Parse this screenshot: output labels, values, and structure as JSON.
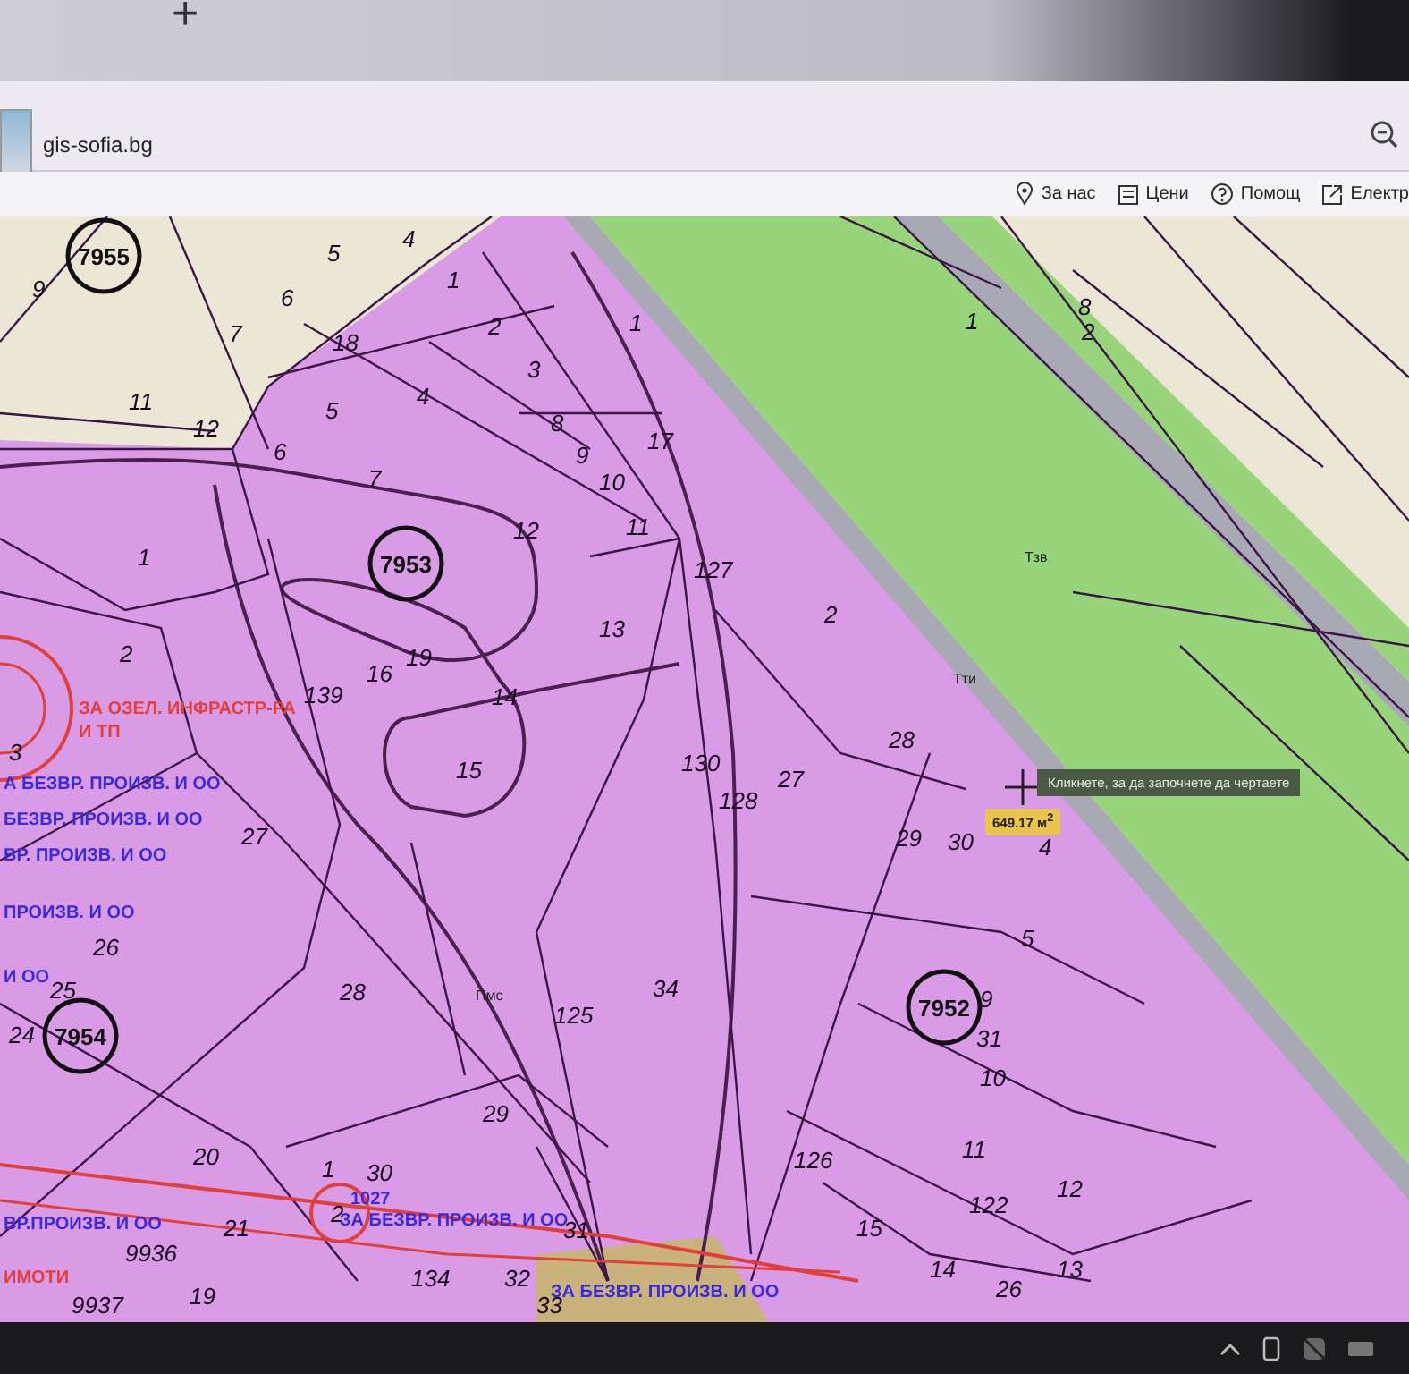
{
  "browser": {
    "new_tab_symbol": "+",
    "site": "gis-sofia.bg"
  },
  "toolbar": [
    {
      "kind": "pin",
      "label": "За нас"
    },
    {
      "kind": "price",
      "label": "Цени"
    },
    {
      "kind": "help",
      "label": "Помощ"
    },
    {
      "kind": "external",
      "label": "Електр"
    }
  ],
  "map": {
    "blocks": [
      "7955",
      "7953",
      "7954",
      "7952"
    ],
    "parcels": [
      "9",
      "4",
      "5",
      "6",
      "7",
      "11",
      "12",
      "1",
      "2",
      "18",
      "3",
      "5",
      "4",
      "8",
      "9",
      "17",
      "10",
      "6",
      "7",
      "11",
      "1",
      "12",
      "127",
      "13",
      "1",
      "2",
      "16",
      "19",
      "139",
      "14",
      "15",
      "130",
      "128",
      "2",
      "28",
      "27",
      "29",
      "30",
      "4",
      "5",
      "9",
      "31",
      "10",
      "11",
      "12",
      "122",
      "126",
      "15",
      "14",
      "26",
      "13",
      "27",
      "26",
      "25",
      "24",
      "28",
      "34",
      "125",
      "29",
      "20",
      "1",
      "8",
      "2",
      "3",
      "30",
      "1",
      "2",
      "31",
      "32",
      "21",
      "9936",
      "19",
      "9937",
      "134",
      "33"
    ],
    "zones": [
      "Тзв",
      "Тти",
      "Пмс"
    ],
    "regulations": [
      {
        "text": "ЗА ОЗЕЛ. ИНФРАСТР-РА",
        "color": "#e0403a"
      },
      {
        "text": "И ТП",
        "color": "#e0403a"
      },
      {
        "text": "А БЕЗВР. ПРОИЗВ. И ОО",
        "color": "#3a2ad8"
      },
      {
        "text": "БЕЗВР. ПРОИЗВ. И ОО",
        "color": "#3a2ad8"
      },
      {
        "text": "ВР. ПРОИЗВ. И ОО",
        "color": "#3a2ad8"
      },
      {
        "text": "ПРОИЗВ. И ОО",
        "color": "#3a2ad8"
      },
      {
        "text": "И ОО",
        "color": "#3a2ad8"
      },
      {
        "text": "ВР.ПРОИЗВ. И ОО",
        "color": "#3a2ad8"
      },
      {
        "text": "ИМОТИ",
        "color": "#e0403a"
      },
      {
        "text": "ЗА БЕЗВР. ПРОИЗВ. И ОО",
        "color": "#3a2ad8"
      },
      {
        "text": "ЗА БЕЗВР. ПРОИЗВ. И ОО",
        "color": "#3a2ad8"
      },
      {
        "text": "1027",
        "color": "#3a2ad8"
      }
    ],
    "tooltip": "Кликнете, за да започнете да чертаете",
    "measurement": "649.17 м$^{2}$"
  }
}
